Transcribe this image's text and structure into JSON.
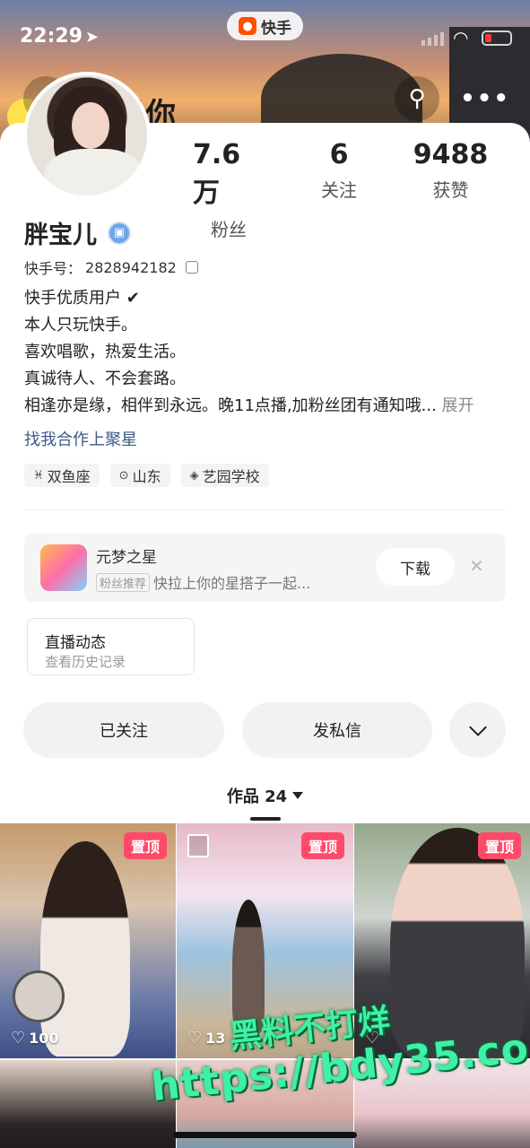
{
  "status": {
    "time": "22:29"
  },
  "app": {
    "brand": "快手"
  },
  "banner": {
    "text": "我很想你"
  },
  "profile": {
    "name": "胖宝儿",
    "kuaishou_id_label": "快手号：",
    "kuaishou_id": "2828942182",
    "stats": [
      {
        "num": "7.6万",
        "label": "粉丝"
      },
      {
        "num": "6",
        "label": "关注"
      },
      {
        "num": "9488",
        "label": "获赞"
      }
    ],
    "bio": [
      "快手优质用户 ✔",
      "本人只玩快手。",
      "喜欢唱歌，热爱生活。",
      "真诚待人、不会套路。",
      "相逢亦是缘，相伴到永远。晚11点播,加粉丝团有通知哦..."
    ],
    "bio_expand": "展开",
    "link": "找我合作上聚星",
    "tags": [
      "双鱼座",
      "山东",
      "艺园学校"
    ]
  },
  "promo": {
    "title": "元梦之星",
    "badge": "粉丝推荐",
    "subtitle": "快拉上你的星搭子一起...",
    "download": "下载"
  },
  "live": {
    "title": "直播动态",
    "subtitle": "查看历史记录"
  },
  "actions": {
    "followed": "已关注",
    "message": "发私信"
  },
  "works": {
    "label": "作品 24"
  },
  "grid": [
    {
      "pin": "置顶",
      "likes": "100"
    },
    {
      "pin": "置顶",
      "likes": "13"
    },
    {
      "pin": "置顶",
      "likes": ""
    }
  ],
  "watermark": {
    "line1": "黑料不打烊",
    "line2": "https://bdy35.co"
  },
  "colors": {
    "pin": "#ff4a6a",
    "link": "#3c5a8a",
    "brand": "#ff5000"
  }
}
